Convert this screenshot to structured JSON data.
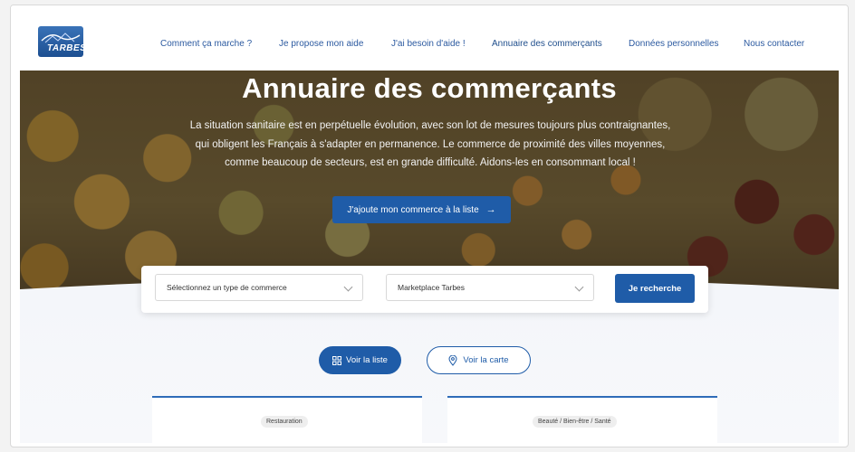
{
  "brand": {
    "logo_text": "TARBES"
  },
  "nav": {
    "items": [
      {
        "label": "Comment ça marche ?"
      },
      {
        "label": "Je propose mon aide"
      },
      {
        "label": "J'ai besoin d'aide !"
      },
      {
        "label": "Annuaire des commerçants"
      },
      {
        "label": "Données personnelles"
      },
      {
        "label": "Nous contacter"
      }
    ],
    "active_index": 3
  },
  "hero": {
    "title": "Annuaire des commerçants",
    "text": "La situation sanitaire est en perpétuelle évolution, avec son lot de mesures toujours plus contraignantes, qui obligent les Français à s'adapter en permanence. Le commerce de proximité des villes moyennes, comme beaucoup de secteurs, est en grande difficulté. Aidons-les en consommant local !",
    "button_label": "J'ajoute mon commerce à la liste",
    "button_arrow": "→"
  },
  "search": {
    "type_select_value": "Sélectionnez un type de commerce",
    "place_select_value": "Marketplace Tarbes",
    "button_label": "Je recherche"
  },
  "view_toggle": {
    "list_icon": "grid-icon",
    "list_label": "Voir la liste",
    "map_icon": "location-pin-icon",
    "map_label": "Voir la carte"
  },
  "cards": [
    {
      "category": "Restauration"
    },
    {
      "category": "Beauté / Bien-être / Santé"
    }
  ],
  "colors": {
    "primary": "#1f5ca8",
    "nav_link": "#2c5aa0",
    "hero_overlay": "#32281400"
  }
}
